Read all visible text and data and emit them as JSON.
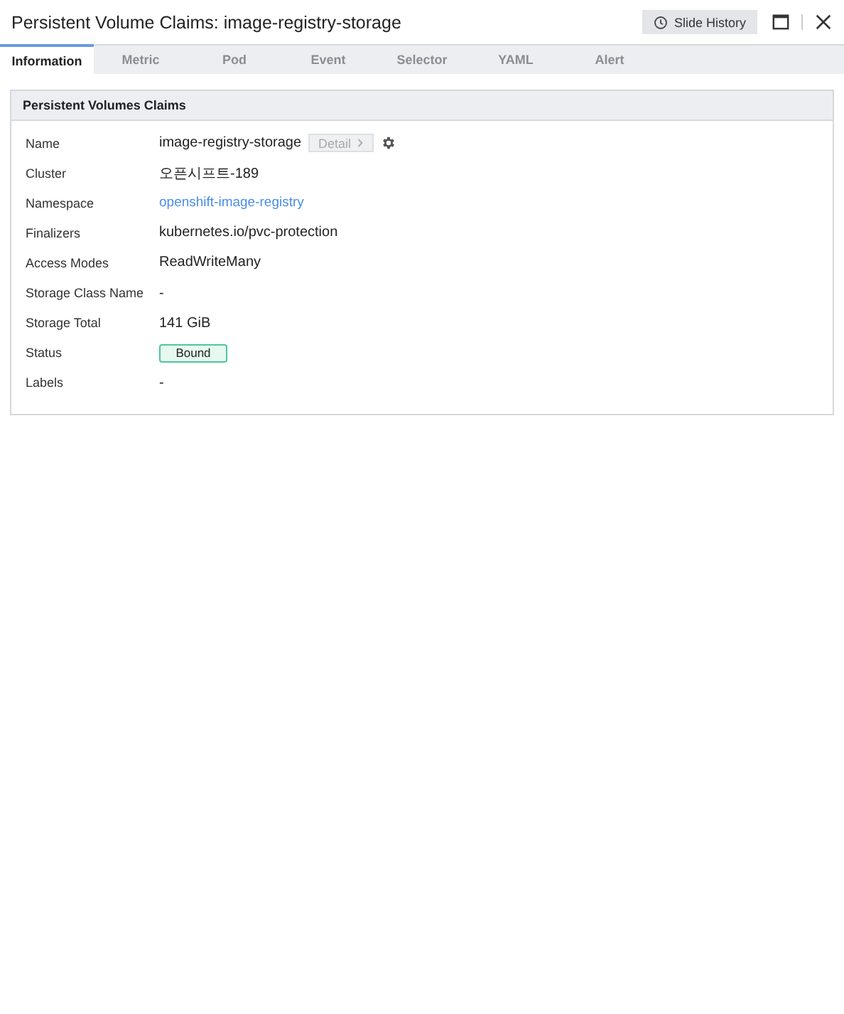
{
  "window": {
    "title": "Persistent Volume Claims: image-registry-storage",
    "history_button": "Slide History"
  },
  "tabs": [
    {
      "label": "Information",
      "selected": true
    },
    {
      "label": "Metric",
      "selected": false
    },
    {
      "label": "Pod",
      "selected": false
    },
    {
      "label": "Event",
      "selected": false
    },
    {
      "label": "Selector",
      "selected": false
    },
    {
      "label": "YAML",
      "selected": false
    },
    {
      "label": "Alert",
      "selected": false
    }
  ],
  "panel": {
    "title": "Persistent Volumes Claims",
    "rows": [
      {
        "label": "Name",
        "kind": "name",
        "value": "image-registry-storage",
        "detail": {
          "label": "Detail",
          "disabled": true
        }
      },
      {
        "label": "Cluster",
        "kind": "text",
        "value": "오픈시프트-189"
      },
      {
        "label": "Namespace",
        "kind": "link",
        "value": "openshift-image-registry"
      },
      {
        "label": "Finalizers",
        "kind": "text",
        "value": "kubernetes.io/pvc-protection"
      },
      {
        "label": "Access Modes",
        "kind": "text",
        "value": "ReadWriteMany"
      },
      {
        "label": "Storage Class Name",
        "kind": "text",
        "value": "-"
      },
      {
        "label": "Storage Total",
        "kind": "text",
        "value": "141 GiB"
      },
      {
        "label": "Status",
        "kind": "badge",
        "value": "Bound"
      },
      {
        "label": "Labels",
        "kind": "text",
        "value": "-"
      }
    ]
  }
}
